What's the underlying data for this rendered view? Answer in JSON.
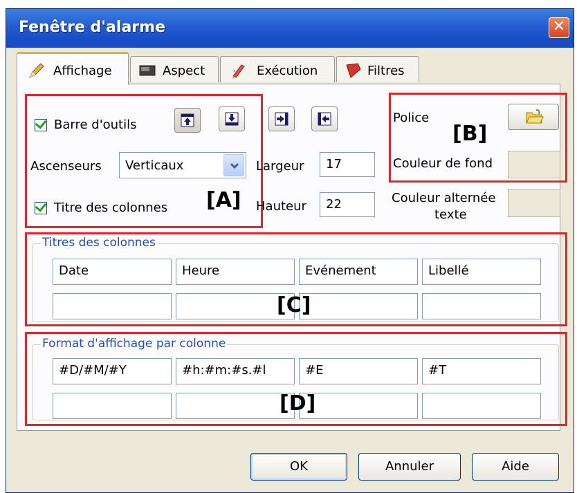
{
  "window": {
    "title": "Fenêtre d'alarme",
    "close_glyph": "✕"
  },
  "tabs": [
    {
      "label": "Affichage",
      "icon": "pencil-icon",
      "active": true
    },
    {
      "label": "Aspect",
      "icon": "monitor-icon"
    },
    {
      "label": "Exécution",
      "icon": "rocket-icon"
    },
    {
      "label": "Filtres",
      "icon": "funnel-icon"
    }
  ],
  "section_a": {
    "tag": "[A]",
    "toolbar_checkbox": {
      "label": "Barre d'outils",
      "checked": true
    },
    "scrollbars": {
      "label": "Ascenseurs",
      "value": "Verticaux"
    },
    "column_titles_checkbox": {
      "label": "Titre des colonnes",
      "checked": true
    }
  },
  "size": {
    "width_label": "Largeur",
    "width_value": "17",
    "height_label": "Hauteur",
    "height_value": "22"
  },
  "section_b": {
    "tag": "[B]",
    "font_label": "Police",
    "bg_color_label": "Couleur de fond",
    "bg_color": "#ece9d8"
  },
  "alt_color": {
    "label_line1": "Couleur alternée",
    "label_line2": "texte",
    "color": "#ece9d8"
  },
  "section_c": {
    "tag": "[C]",
    "group_label": "Titres des colonnes",
    "row1": [
      "Date",
      "Heure",
      "Evénement",
      "Libellé"
    ],
    "row2": [
      "",
      "",
      "",
      ""
    ]
  },
  "section_d": {
    "tag": "[D]",
    "group_label": "Format d'affichage par colonne",
    "row1": [
      "#D/#M/#Y",
      "#h:#m:#s.#l",
      "#E",
      "#T"
    ],
    "row2": [
      "",
      "",
      "",
      ""
    ]
  },
  "buttons": {
    "ok": "OK",
    "cancel": "Annuler",
    "help": "Aide"
  },
  "colors": {
    "title_bar": "#2a64d6",
    "highlight_boxes": "#e0262b",
    "check_mark": "#21a121",
    "active_tab_top": "#e8a94b"
  }
}
